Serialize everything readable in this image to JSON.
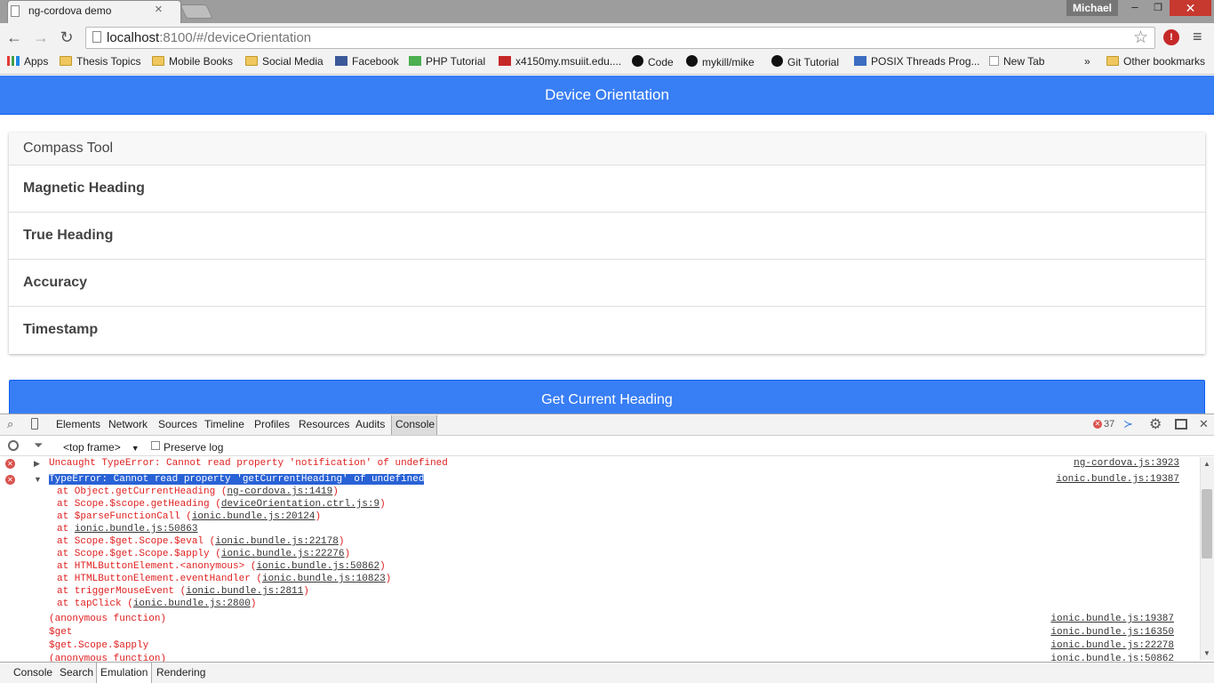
{
  "browser": {
    "tab_title": "ng-cordova demo",
    "profile_name": "Michael",
    "url_host": "localhost",
    "url_path": ":8100/#/deviceOrientation",
    "window_controls": {
      "minimize": "–",
      "maximize": "❐",
      "close": "✕"
    }
  },
  "bookmarks": [
    {
      "label": "Apps",
      "icon": "apps-icon"
    },
    {
      "label": "Thesis Topics",
      "icon": "folder-icon"
    },
    {
      "label": "Mobile Books",
      "icon": "folder-icon"
    },
    {
      "label": "Social Media",
      "icon": "folder-icon"
    },
    {
      "label": "Facebook",
      "icon": "facebook-icon"
    },
    {
      "label": "PHP Tutorial",
      "icon": "w3schools-icon"
    },
    {
      "label": "x4150my.msuiit.edu....",
      "icon": "iit-icon"
    },
    {
      "label": "Code",
      "icon": "github-icon"
    },
    {
      "label": "mykill/mike",
      "icon": "github-icon"
    },
    {
      "label": "Git Tutorial",
      "icon": "github-icon"
    },
    {
      "label": "POSIX Threads Prog...",
      "icon": "posix-icon"
    },
    {
      "label": "New Tab",
      "icon": "page-icon"
    }
  ],
  "bookmarks_overflow": "»",
  "other_bookmarks": "Other bookmarks",
  "app": {
    "header_title": "Device Orientation",
    "card_title": "Compass Tool",
    "items": [
      "Magnetic Heading",
      "True Heading",
      "Accuracy",
      "Timestamp"
    ],
    "button_label": "Get Current Heading"
  },
  "devtools": {
    "tabs": [
      "Elements",
      "Network",
      "Sources",
      "Timeline",
      "Profiles",
      "Resources",
      "Audits",
      "Console"
    ],
    "active_tab": "Console",
    "error_count": "37",
    "frame": "<top frame>",
    "preserve_log": "Preserve log",
    "messages": [
      {
        "text": "Uncaught TypeError: Cannot read property 'notification' of undefined",
        "source": "ng-cordova.js:3923"
      },
      {
        "text": "TypeError: Cannot read property 'getCurrentHeading' of undefined",
        "source": "ionic.bundle.js:19387"
      }
    ],
    "stack": [
      {
        "pre": "at Object.getCurrentHeading (",
        "link": "ng-cordova.js:1419",
        "post": ")"
      },
      {
        "pre": "at Scope.$scope.getHeading (",
        "link": "deviceOrientation.ctrl.js:9",
        "post": ")"
      },
      {
        "pre": "at $parseFunctionCall (",
        "link": "ionic.bundle.js:20124",
        "post": ")"
      },
      {
        "pre": "at ",
        "link": "ionic.bundle.js:50863",
        "post": ""
      },
      {
        "pre": "at Scope.$get.Scope.$eval (",
        "link": "ionic.bundle.js:22178",
        "post": ")"
      },
      {
        "pre": "at Scope.$get.Scope.$apply (",
        "link": "ionic.bundle.js:22276",
        "post": ")"
      },
      {
        "pre": "at HTMLButtonElement.<anonymous> (",
        "link": "ionic.bundle.js:50862",
        "post": ")"
      },
      {
        "pre": "at HTMLButtonElement.eventHandler (",
        "link": "ionic.bundle.js:10823",
        "post": ")"
      },
      {
        "pre": "at triggerMouseEvent (",
        "link": "ionic.bundle.js:2811",
        "post": ")"
      },
      {
        "pre": "at tapClick (",
        "link": "ionic.bundle.js:2800",
        "post": ")"
      }
    ],
    "trace": [
      {
        "fn": "(anonymous function)",
        "source": "ionic.bundle.js:19387"
      },
      {
        "fn": "$get",
        "source": "ionic.bundle.js:16350"
      },
      {
        "fn": "$get.Scope.$apply",
        "source": "ionic.bundle.js:22278"
      },
      {
        "fn": "(anonymous function)",
        "source": "ionic.bundle.js:50862"
      }
    ],
    "drawer_tabs": [
      "Console",
      "Search",
      "Emulation",
      "Rendering"
    ],
    "drawer_active": "Emulation"
  }
}
